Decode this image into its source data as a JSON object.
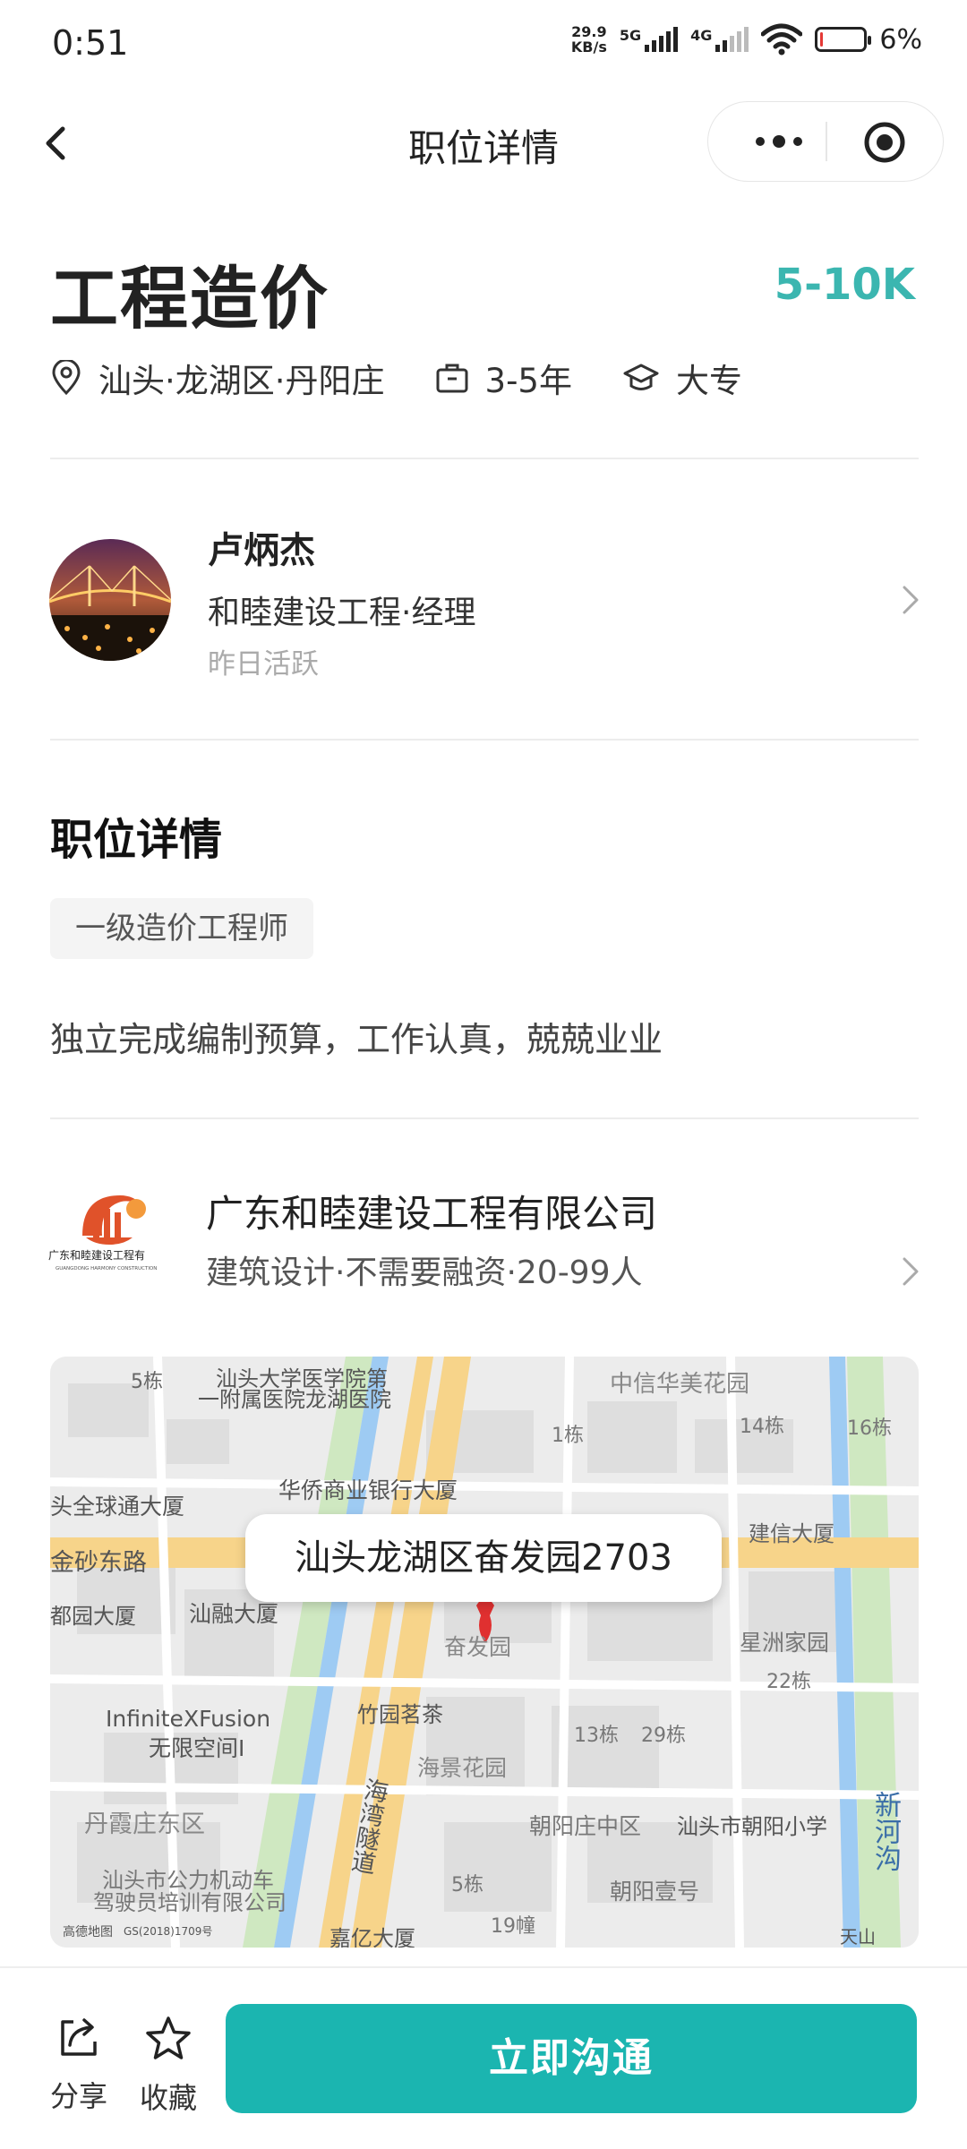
{
  "status_bar": {
    "time": "0:51",
    "net_speed_value": "29.9",
    "net_speed_unit": "KB/s",
    "net_type_1": "5G",
    "net_type_2": "4G",
    "battery_percent": "6%",
    "battery_level": 0.06,
    "battery_color": "#e53935"
  },
  "nav": {
    "title": "职位详情",
    "back_icon": "chevron-left-icon",
    "more_icon": "more-dots-icon",
    "close_icon": "target-circle-icon"
  },
  "job": {
    "title": "工程造价",
    "salary": "5-10K",
    "salary_color": "#3bb6b0",
    "location": "汕头·龙湖区·丹阳庄",
    "experience": "3-5年",
    "education": "大专"
  },
  "recruiter": {
    "name": "卢炳杰",
    "company_title": "和睦建设工程·经理",
    "active_status": "昨日活跃"
  },
  "job_detail": {
    "section_title": "职位详情",
    "tag": "一级造价工程师",
    "description": "独立完成编制预算，工作认真，兢兢业业"
  },
  "company": {
    "name": "广东和睦建设工程有限公司",
    "meta": "建筑设计·不需要融资·20-99人",
    "logo_text": "广东和睦建设工程有"
  },
  "map": {
    "address_bubble": "汕头龙湖区奋发园2703",
    "labels": [
      "5栋",
      "汕头大学医学院第",
      "一附属医院龙湖医院",
      "中信华美花园",
      "1栋",
      "14栋",
      "16栋",
      "华侨商业银行大厦",
      "头全球通大厦",
      "建信大厦",
      "金砂东路",
      "汕融大厦",
      "都园大厦",
      "奋发园",
      "星洲家园",
      "22栋",
      "InfiniteXFusion",
      "无限空间I",
      "竹园茗茶",
      "13栋",
      "29栋",
      "海湾隧道",
      "海景花园",
      "丹霞庄东区",
      "朝阳庄中区",
      "汕头市朝阳小学",
      "新河沟",
      "汕头市公力机动车",
      "驾驶员培训有限公司",
      "5栋",
      "朝阳壹号",
      "嘉亿大厦",
      "19幢",
      "高德地图",
      "GS(2018)1709号",
      "天山"
    ]
  },
  "bottom_bar": {
    "share_label": "分享",
    "favorite_label": "收藏",
    "chat_button": "立即沟通",
    "button_color": "#1bb5b0"
  }
}
